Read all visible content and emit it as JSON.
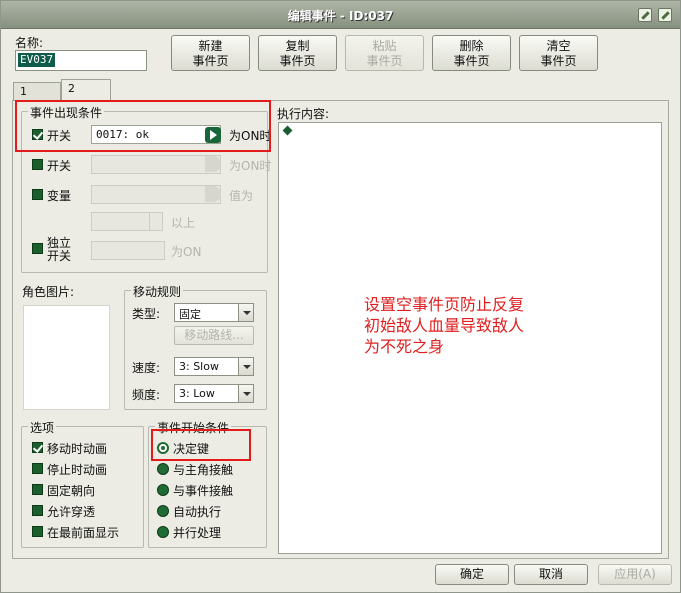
{
  "window": {
    "title": "编辑事件 - ID:037"
  },
  "name": {
    "label": "名称:",
    "value": "EV037"
  },
  "toolbar": {
    "new_label": "新建\n事件页",
    "copy_label": "复制\n事件页",
    "paste_label": "粘贴\n事件页",
    "delete_label": "删除\n事件页",
    "clear_label": "清空\n事件页"
  },
  "tabs": [
    {
      "label": "1"
    },
    {
      "label": "2"
    }
  ],
  "conditions": {
    "title": "事件出现条件",
    "switch1": {
      "label": "开关",
      "value": "0017: ok",
      "suffix": "为ON时"
    },
    "switch2": {
      "label": "开关",
      "suffix": "为ON时"
    },
    "variable": {
      "label": "变量",
      "suffix": "值为",
      "above": "以上"
    },
    "self_switch": {
      "label": "独立\n开关",
      "suffix": "为ON"
    }
  },
  "graphic": {
    "label": "角色图片:"
  },
  "movement": {
    "title": "移动规则",
    "type_label": "类型:",
    "type_value": "固定",
    "route_label": "移动路线...",
    "speed_label": "速度:",
    "speed_value": "3: Slow",
    "freq_label": "频度:",
    "freq_value": "3: Low"
  },
  "options": {
    "title": "选项",
    "items": [
      {
        "label": "移动时动画",
        "checked": true
      },
      {
        "label": "停止时动画",
        "checked": false
      },
      {
        "label": "固定朝向",
        "checked": false
      },
      {
        "label": "允许穿透",
        "checked": false
      },
      {
        "label": "在最前面显示",
        "checked": false
      }
    ]
  },
  "trigger": {
    "title": "事件开始条件",
    "items": [
      {
        "label": "决定键",
        "selected": true
      },
      {
        "label": "与主角接触",
        "selected": false
      },
      {
        "label": "与事件接触",
        "selected": false
      },
      {
        "label": "自动执行",
        "selected": false
      },
      {
        "label": "并行处理",
        "selected": false
      }
    ]
  },
  "exec": {
    "label": "执行内容:"
  },
  "annotation": {
    "line1": "设置空事件页防止反复",
    "line2": "初始敌人血量导致敌人",
    "line3": "为不死之身"
  },
  "footer": {
    "ok": "确定",
    "cancel": "取消",
    "apply": "应用(A)"
  },
  "colors": {
    "annotation": "#e02020",
    "highlight": "#e31b1b",
    "accent": "#1b5f2c"
  }
}
